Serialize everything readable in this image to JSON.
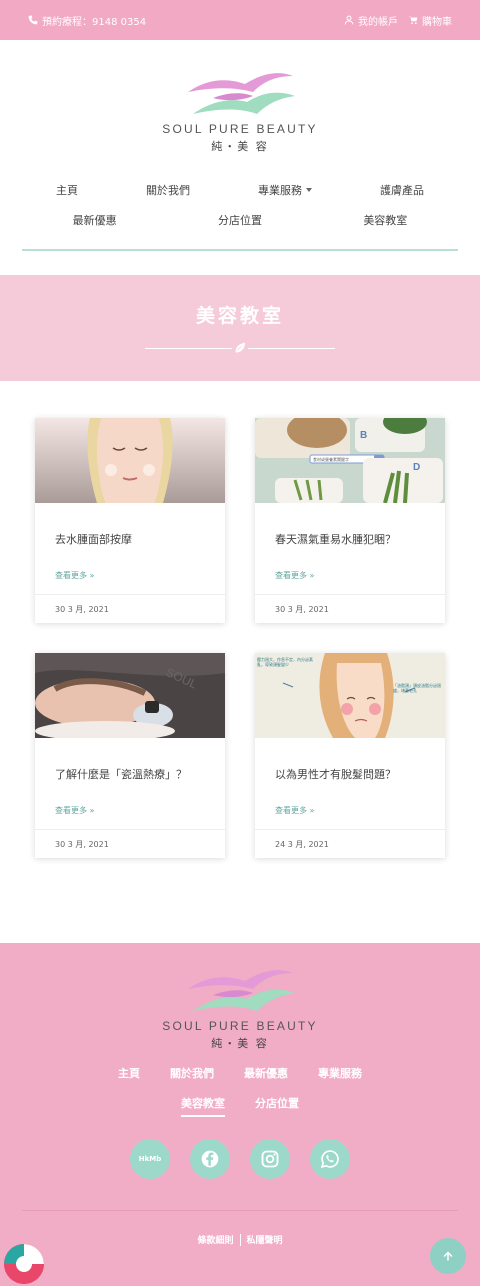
{
  "topbar": {
    "booking": "預約療程：9148 0354",
    "account": "我的帳戶",
    "cart": "購物車"
  },
  "logo": {
    "brand": "SOUL PURE BEAUTY",
    "brand_zh": "純・美 容"
  },
  "nav": {
    "row1": [
      "主頁",
      "關於我們",
      "專業服務",
      "護膚產品"
    ],
    "row2": [
      "最新優惠",
      "分店位置",
      "美容教室"
    ]
  },
  "hero": {
    "title": "美容教室"
  },
  "cards": [
    {
      "title": "去水腫面部按摩",
      "more": "查看更多 »",
      "date": "30 3 月, 2021"
    },
    {
      "title": "春天濕氣重易水腫犯睏？",
      "more": "查看更多 »",
      "date": "30 3 月, 2021"
    },
    {
      "title": "了解什麼是「瓷溫熱療」？",
      "more": "查看更多 »",
      "date": "30 3 月, 2021"
    },
    {
      "title": "以為男性才有脫髮問題？",
      "more": "查看更多 »",
      "date": "24 3 月, 2021"
    }
  ],
  "thumbs": {
    "card2": {
      "search_placeholder": "食材或營養素關鍵字",
      "label_b": "B",
      "label_d": "D"
    },
    "card4": {
      "note1": "壓力過大、作息不定，內分泌紊亂，導致頭髮變少",
      "note2": "「油脂頭」頭皮油脂分泌過盛，堵塞毛孔"
    }
  },
  "footer": {
    "nav_row1": [
      "主頁",
      "關於我們",
      "最新優惠",
      "專業服務"
    ],
    "nav_row2": [
      "美容教室",
      "分店位置"
    ],
    "legal": [
      "條款細則",
      "私隱聲明"
    ],
    "hkmb": "HkMb"
  },
  "colors": {
    "brand_pink": "#f2a9c3",
    "hero_pink": "#f5cbd9",
    "mint": "#9cd9cb",
    "link_teal": "#5fa69e"
  }
}
